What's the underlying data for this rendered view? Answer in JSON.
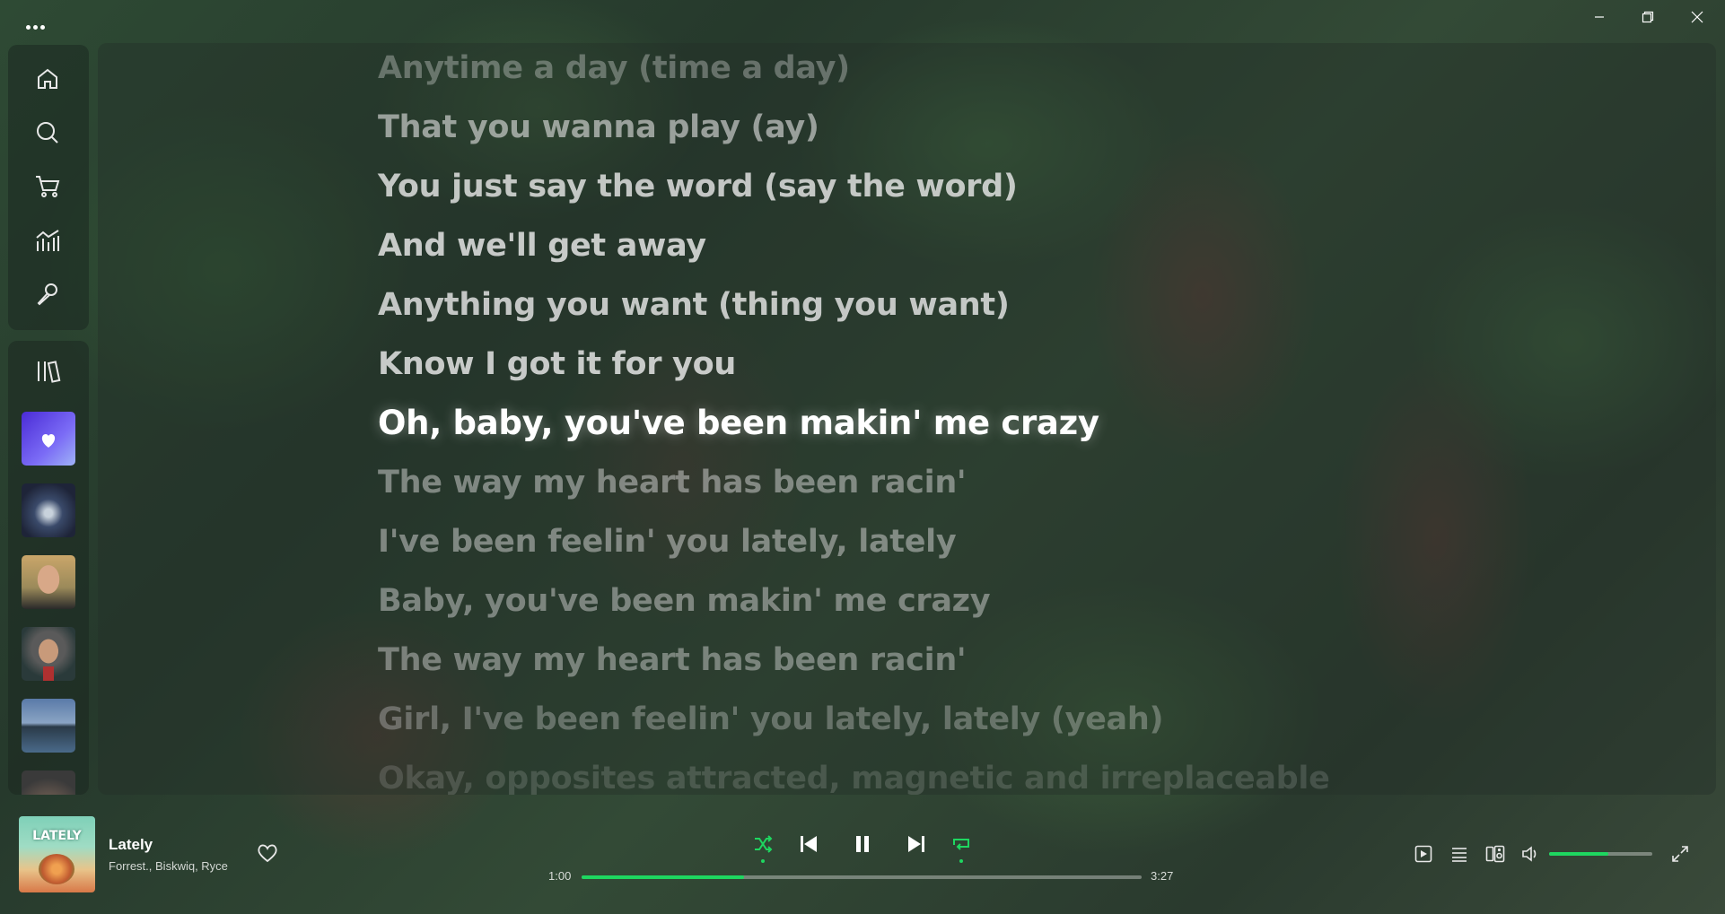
{
  "window": {
    "menu_icon": "more-horizontal-icon",
    "controls": [
      "minimize-icon",
      "restore-icon",
      "close-icon"
    ]
  },
  "sidebar": {
    "nav": [
      "home-icon",
      "search-icon",
      "cart-icon",
      "charts-icon",
      "microphone-icon"
    ],
    "library_icon": "library-icon",
    "playlists": [
      {
        "name": "liked-songs",
        "icon": "heart-icon",
        "color": "#5b3ef0"
      },
      {
        "name": "playlist-2"
      },
      {
        "name": "playlist-3"
      },
      {
        "name": "playlist-4"
      },
      {
        "name": "playlist-5"
      },
      {
        "name": "playlist-6"
      }
    ]
  },
  "lyrics": {
    "lines": [
      "Anytime a day (time a day)",
      "That you wanna play (ay)",
      "You just say the word (say the word)",
      "And we'll get away",
      "Anything you want (thing you want)",
      "Know I got it for you",
      "Oh, baby, you've been makin' me crazy",
      "The way my heart has been racin'",
      "I've been feelin' you lately, lately",
      "Baby, you've been makin' me crazy",
      "The way my heart has been racin'",
      "Girl, I've been feelin' you lately, lately (yeah)",
      "Okay, opposites attracted, magnetic and irreplaceable"
    ],
    "active_index": 6
  },
  "player": {
    "cover_text": "LATELY",
    "title": "Lately",
    "artists": "Forrest., Biskwiq, Ryce",
    "elapsed": "1:00",
    "duration": "3:27",
    "progress": 0.29,
    "volume": 0.57,
    "shuffle_on": true,
    "repeat_on": true,
    "accent": "#1ed760"
  }
}
